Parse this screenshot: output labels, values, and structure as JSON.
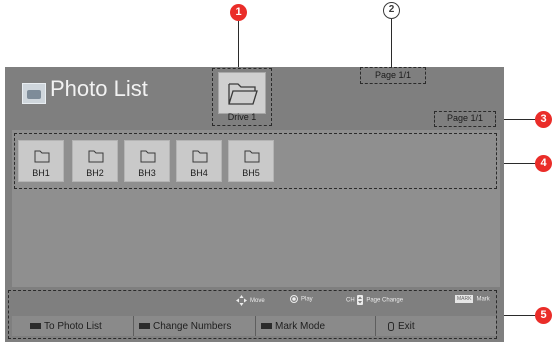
{
  "header": {
    "title": "Photo List"
  },
  "drive": {
    "label": "Drive 1"
  },
  "paging": {
    "page_top": "Page 1/1",
    "page_list": "Page 1/1"
  },
  "folders": [
    "BH1",
    "BH2",
    "BH3",
    "BH4",
    "BH5"
  ],
  "legend": {
    "move": "Move",
    "play": "Play",
    "ch_prefix": "CH",
    "page_change": "Page Change",
    "mark_badge": "MARK",
    "mark": "Mark"
  },
  "buttons": {
    "to_photo_list": "To Photo List",
    "change_numbers": "Change Numbers",
    "mark_mode": "Mark Mode",
    "exit": "Exit"
  },
  "callouts": {
    "c1": "1",
    "c2": "2",
    "c3": "3",
    "c4": "4",
    "c5": "5"
  },
  "colors": {
    "marker_red": "#ea2d29",
    "screen_gray": "#7f7f7f",
    "tile_gray": "#c9c9c9"
  },
  "icons": [
    "photo-icon",
    "folder-open-icon",
    "folder-icon",
    "dpad-icon",
    "ok-button-icon",
    "ch-updown-icon",
    "color-key-icon",
    "exit-key-icon"
  ]
}
